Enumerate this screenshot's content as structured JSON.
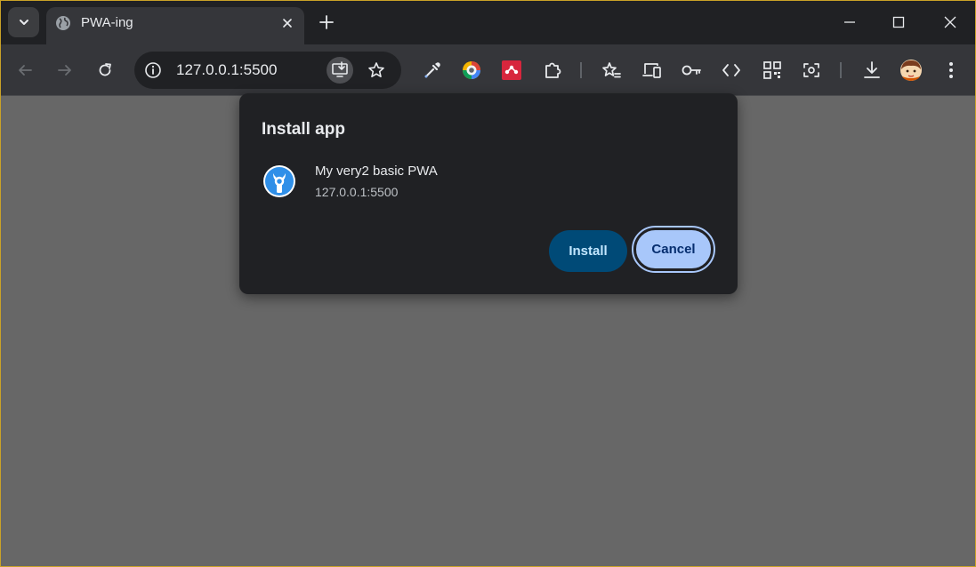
{
  "tab": {
    "title": "PWA-ing",
    "close_icon": "close-icon",
    "favicon": "globe-icon"
  },
  "toolbar": {
    "url": "127.0.0.1:5500",
    "back_icon": "back-arrow-icon",
    "forward_icon": "forward-arrow-icon",
    "reload_icon": "reload-icon",
    "extensions": [
      "eyedropper-icon",
      "color-picker-icon",
      "mendeley-icon",
      "puzzle-icon",
      "reading-list-star-icon",
      "device-toolbar-icon",
      "password-key-icon",
      "code-icon",
      "qr-code-icon",
      "lens-icon",
      "download-icon",
      "profile-avatar"
    ]
  },
  "dialog": {
    "title": "Install app",
    "app_name": "My very2 basic PWA",
    "app_url": "127.0.0.1:5500",
    "install_label": "Install",
    "cancel_label": "Cancel"
  },
  "colors": {
    "page_bg": "#676767",
    "tabstrip_bg": "#202124",
    "toolbar_bg": "#35363a",
    "dialog_bg": "#202124",
    "install_button_bg": "#004a77",
    "cancel_button_bg": "#a8c7fa"
  }
}
